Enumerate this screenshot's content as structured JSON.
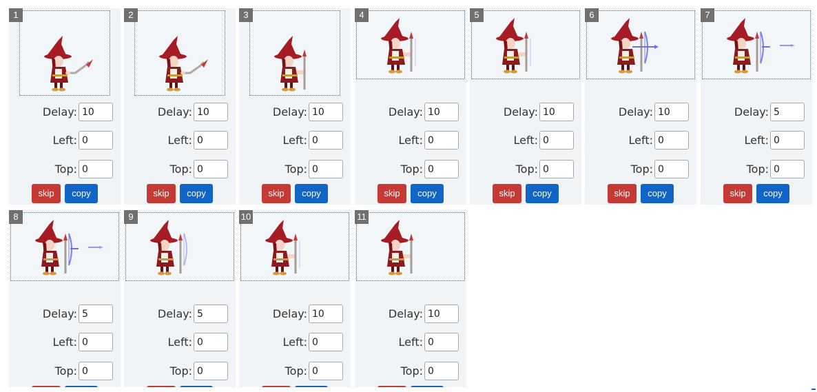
{
  "labels": {
    "delay": "Delay:",
    "left": "Left:",
    "top": "Top:",
    "skip": "skip",
    "copy": "copy"
  },
  "colors": {
    "card_bg": "#f1f4f7",
    "badge_bg": "#707070",
    "skip_bg": "#c53a35",
    "copy_bg": "#1065c6",
    "hat": "#a51c24",
    "robe": "#8e1a1e",
    "bow": "#6f6ff0"
  },
  "frames": [
    {
      "num": "1",
      "delay": "10",
      "left": "0",
      "top": "0",
      "pose": "staff-forward"
    },
    {
      "num": "2",
      "delay": "10",
      "left": "0",
      "top": "0",
      "pose": "staff-forward"
    },
    {
      "num": "3",
      "delay": "10",
      "left": "0",
      "top": "0",
      "pose": "staff-upright"
    },
    {
      "num": "4",
      "delay": "10",
      "left": "0",
      "top": "0",
      "pose": "staff-upright-faint"
    },
    {
      "num": "5",
      "delay": "10",
      "left": "0",
      "top": "0",
      "pose": "staff-upright-faint"
    },
    {
      "num": "6",
      "delay": "10",
      "left": "0",
      "top": "0",
      "pose": "bow-drawn"
    },
    {
      "num": "7",
      "delay": "5",
      "left": "0",
      "top": "0",
      "pose": "bow-arrow"
    },
    {
      "num": "8",
      "delay": "5",
      "left": "0",
      "top": "0",
      "pose": "bow-arrow"
    },
    {
      "num": "9",
      "delay": "5",
      "left": "0",
      "top": "0",
      "pose": "bow-fade"
    },
    {
      "num": "10",
      "delay": "10",
      "left": "0",
      "top": "0",
      "pose": "staff-upright-faint"
    },
    {
      "num": "11",
      "delay": "10",
      "left": "0",
      "top": "0",
      "pose": "staff-upright"
    }
  ]
}
